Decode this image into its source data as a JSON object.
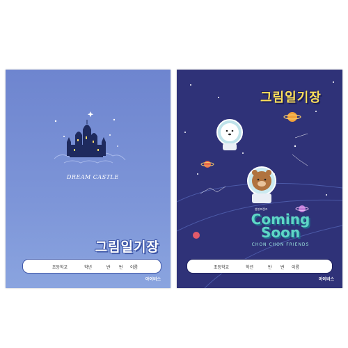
{
  "left_cover": {
    "title": "그림일기장",
    "subtitle": "DREAM CASTLE",
    "namebox": {
      "school": "초등학교",
      "grade": "학년",
      "class": "반",
      "number": "번",
      "name": "이름"
    },
    "publisher": "아이비스",
    "colors": {
      "bg": "#7a91d6",
      "accent": "#3f57a8"
    }
  },
  "right_cover": {
    "title": "그림일기장",
    "headline_1": "Coming",
    "headline_2": "Soon",
    "tagline": "CHON CHON FRIENDS",
    "small_label": "쏭쏭프렌즈",
    "namebox": {
      "school": "초등학교",
      "grade": "학년",
      "class": "반",
      "number": "번",
      "name": "이름"
    },
    "publisher": "아이비스",
    "colors": {
      "bg": "#2f3278",
      "title": "#ffe15a",
      "headline": "#5fd6c6"
    }
  }
}
